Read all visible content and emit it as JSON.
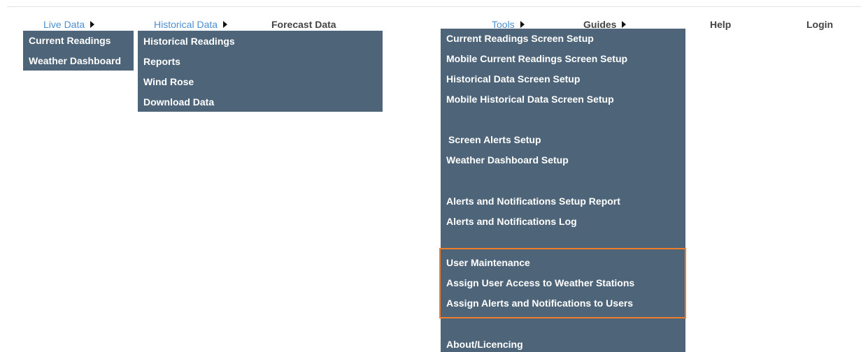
{
  "nav": {
    "live_data": "Live Data",
    "historical_data": "Historical Data",
    "forecast_data": "Forecast Data",
    "tools": "Tools",
    "guides": "Guides",
    "help": "Help",
    "login": "Login"
  },
  "live_menu": [
    "Current Readings",
    "Weather Dashboard"
  ],
  "historical_menu": [
    "Historical Readings",
    "Reports",
    "Wind Rose",
    "Download Data"
  ],
  "tools_menu": [
    "Current Readings Screen Setup",
    "Mobile Current Readings Screen Setup",
    "Historical Data Screen Setup",
    "Mobile Historical Data Screen Setup",
    "Screen Alerts Setup",
    "Weather Dashboard Setup",
    "Alerts and Notifications Setup Report",
    "Alerts and Notifications Log",
    "User Maintenance",
    "Assign User Access to Weather Stations",
    "Assign Alerts and Notifications to Users",
    "About/Licencing"
  ],
  "colors": {
    "menu_bg": "#4e6579",
    "link_blue": "#4d8fd0",
    "highlight_orange": "#ee7d2e"
  }
}
